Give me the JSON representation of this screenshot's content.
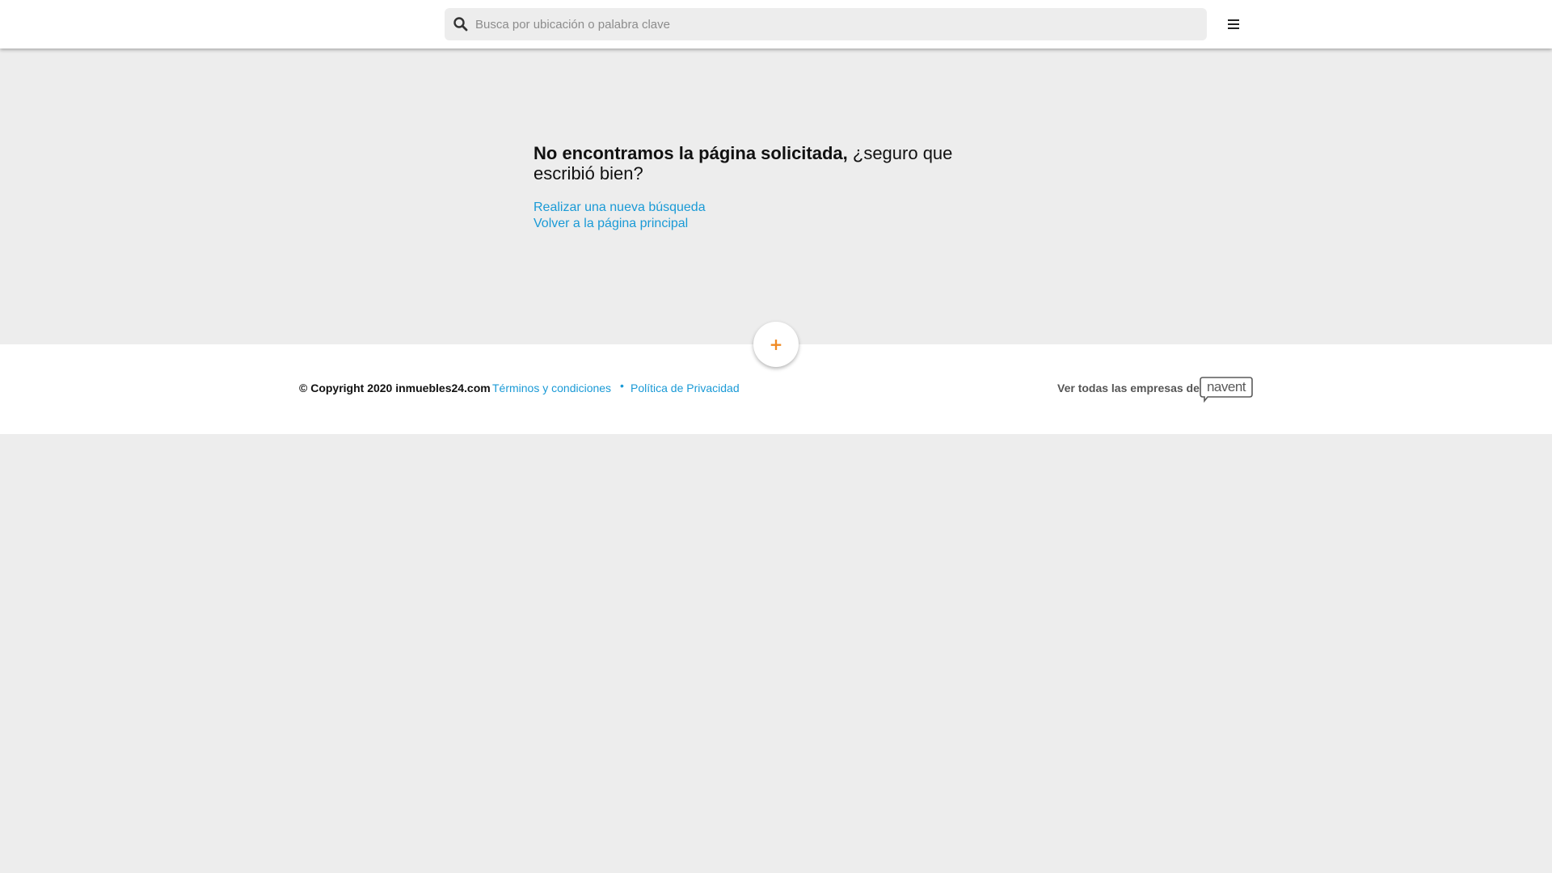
{
  "header": {
    "search": {
      "placeholder": "Busca por ubicación o palabra clave",
      "value": ""
    },
    "menu_icon": "hamburger-menu-icon"
  },
  "error": {
    "title_bold": "No encontramos la página solicitada,",
    "title_rest": " ¿seguro que escribió bien?",
    "links": [
      "Realizar una nueva búsqueda",
      "Volver a la página principal"
    ]
  },
  "fab": {
    "label": "+"
  },
  "footer": {
    "copyright": "© Copyright 2020 inmuebles24.com",
    "terms": "Términos y condiciones",
    "separator": "•",
    "privacy": "Política de Privacidad",
    "companies_text": "Ver todas las empresas de",
    "logo_text": "navent"
  },
  "colors": {
    "link": "#1a9ad6",
    "accent": "#f08a24",
    "background": "#ededed",
    "surface": "#ffffff"
  }
}
